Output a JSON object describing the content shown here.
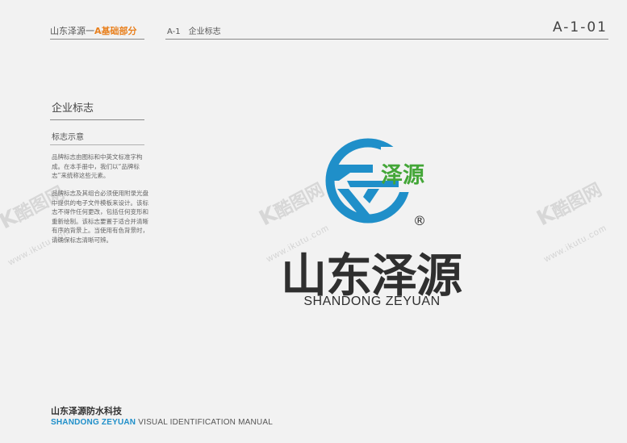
{
  "header": {
    "series_prefix": "山东泽源一",
    "series_accent": "A基础部分",
    "section_code": "A-1",
    "section_name": "企业标志",
    "page_code": "A-1-01"
  },
  "section": {
    "title": "企业标志",
    "subtitle": "标志示意",
    "paragraphs": [
      "品牌标志由图标和中英文标准字构成。在本手册中，我们以“品牌标志”来统称这些元素。",
      "品牌标志及其组合必须使用附录光盘中提供的电子文件模板来设计。该标志不得作任何更改，包括任何变形和重新绘制。该标志要置于适合并清晰有序的背景上。当使用有色背景时，请确保标志清晰可辨。"
    ]
  },
  "logo": {
    "emblem_text": "泽源",
    "registered_mark": "®",
    "wordmark_cn": "山东泽源",
    "wordmark_en": "SHANDONG ZEYUAN",
    "colors": {
      "blue": "#1f8fc9",
      "green": "#43a637",
      "dark": "#2f2f2f"
    }
  },
  "footer": {
    "company_cn": "山东泽源防水科技",
    "brand_en": "SHANDONG ZEYUAN",
    "manual_en": "VISUAL IDENTIFICATION MANUAL"
  },
  "watermark": {
    "brand": "酷图网",
    "url": "www.ikutu.com"
  }
}
